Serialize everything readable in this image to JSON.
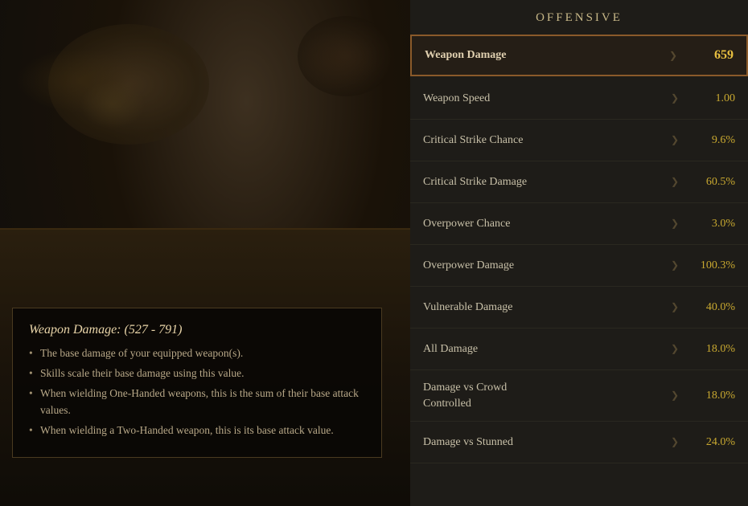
{
  "scene": {
    "tooltip": {
      "title": "Weapon Damage: (527 - 791)",
      "bullets": [
        "The base damage of your equipped weapon(s).",
        "Skills scale their base damage using this value.",
        "When wielding One-Handed weapons, this is the sum of their base attack values.",
        "When wielding a Two-Handed weapon, this is its base attack value."
      ]
    }
  },
  "offensive": {
    "header": "OFFENSIVE",
    "stats": [
      {
        "name": "Weapon Damage",
        "value": "659",
        "highlighted": true
      },
      {
        "name": "Weapon Speed",
        "value": "1.00",
        "highlighted": false
      },
      {
        "name": "Critical Strike Chance",
        "value": "9.6%",
        "highlighted": false
      },
      {
        "name": "Critical Strike Damage",
        "value": "60.5%",
        "highlighted": false
      },
      {
        "name": "Overpower Chance",
        "value": "3.0%",
        "highlighted": false
      },
      {
        "name": "Overpower Damage",
        "value": "100.3%",
        "highlighted": false
      },
      {
        "name": "Vulnerable Damage",
        "value": "40.0%",
        "highlighted": false
      },
      {
        "name": "All Damage",
        "value": "18.0%",
        "highlighted": false
      },
      {
        "name": "Damage vs Crowd\nControlled",
        "value": "18.0%",
        "highlighted": false
      },
      {
        "name": "Damage vs Stunned",
        "value": "24.0%",
        "highlighted": false
      }
    ]
  }
}
